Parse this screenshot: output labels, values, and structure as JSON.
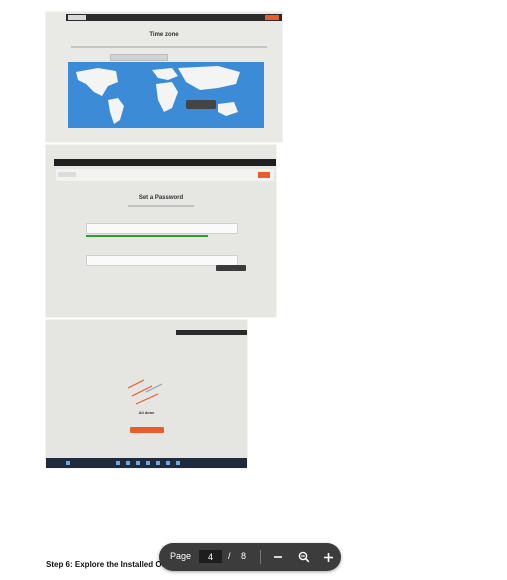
{
  "photos": {
    "timezone": {
      "heading": "Time zone"
    },
    "password": {
      "title": "Set a Password"
    },
    "alldone": {
      "title": "All done"
    }
  },
  "step_heading": "Step 6: Explore the Installed OS",
  "toolbar": {
    "page_label": "Page",
    "current_page": "4",
    "separator": "/",
    "total_pages": "8"
  },
  "icons": {
    "zoom_out": "minus-icon",
    "zoom_fit": "magnifier-icon",
    "zoom_in": "plus-icon"
  },
  "colors": {
    "ubuntu_orange": "#e85d2a",
    "toolbar_bg": "#3c3c3c",
    "map_blue": "#3b8bd6",
    "strength_green": "#2f9e2f"
  }
}
